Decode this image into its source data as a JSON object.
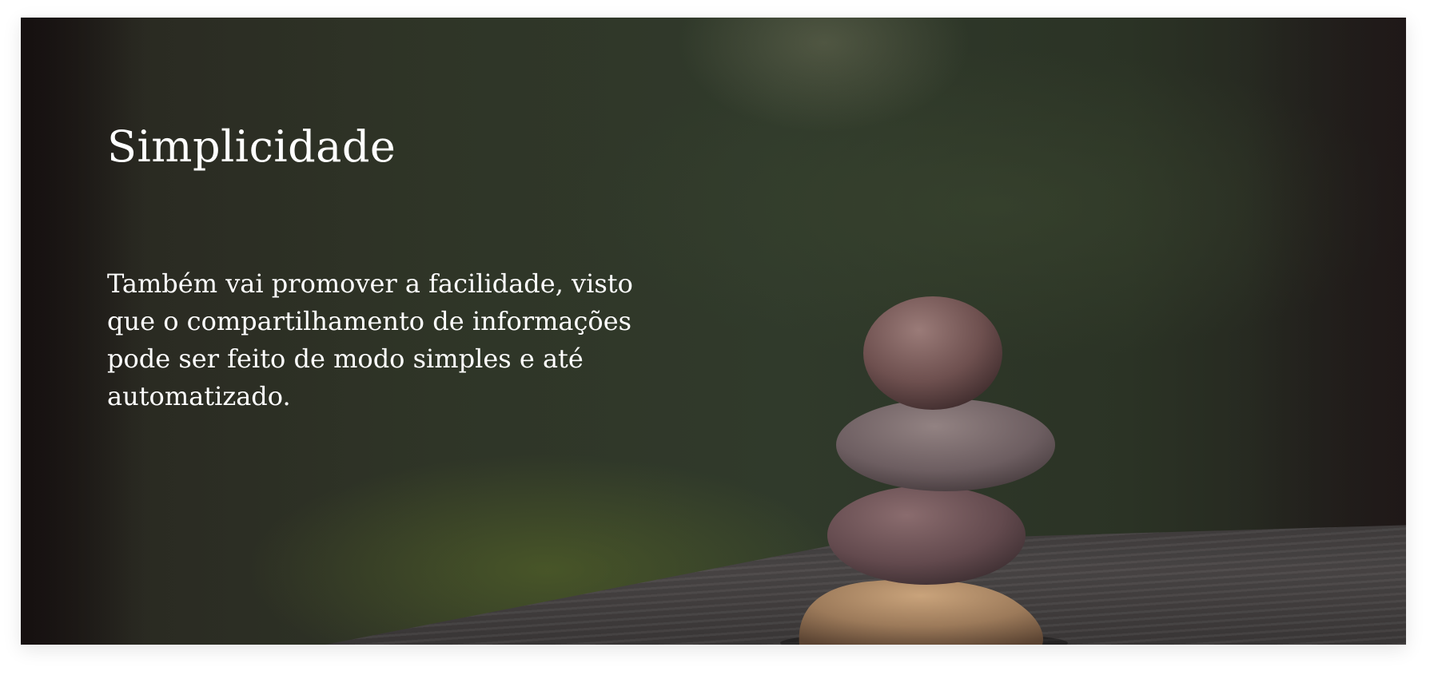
{
  "slide": {
    "title": "Simplicidade",
    "body": "Também vai promover a facilidade, visto que o compartilhamento de informações pode ser feito de modo simples e até automatizado."
  },
  "colors": {
    "background_foliage": "#303a2b",
    "text": "#ffffff",
    "page": "#ffffff"
  }
}
